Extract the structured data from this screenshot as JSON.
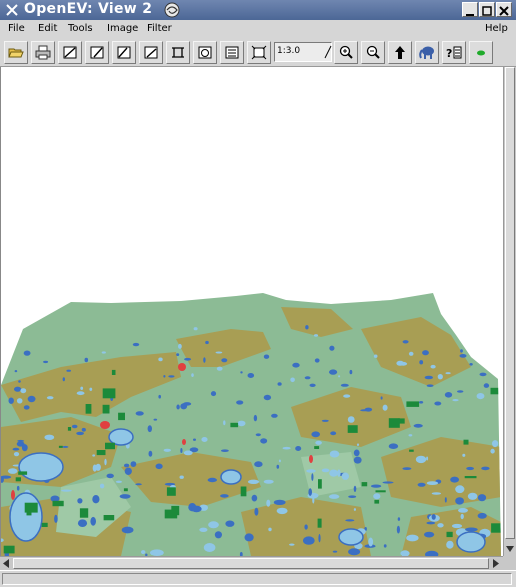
{
  "window": {
    "title": "OpenEV: View 2"
  },
  "menu": {
    "items": [
      "File",
      "Edit",
      "Tools",
      "Image",
      "Filter"
    ],
    "help": "Help"
  },
  "toolbar": {
    "buttons": [
      "open-icon",
      "print-icon",
      "select-tool-icon",
      "edit-tool-icon",
      "draw-tool-icon",
      "measure-tool-icon",
      "roi-tool-icon",
      "rotate-icon",
      "layers-icon",
      "fit-extents-icon",
      "zoom-in-icon",
      "zoom-out-icon",
      "up-arrow-icon",
      "elephant-icon",
      "help-info-icon",
      "green-dot-icon"
    ],
    "zoom_value": "1:3.0"
  },
  "status": {
    "text": ""
  },
  "colors": {
    "background": "#ffffff",
    "grassland": "#8cbb95",
    "cropland": "#a89e54",
    "forest": "#1c8a3a",
    "water_dark": "#3b6fc2",
    "water_light": "#8fc6e6",
    "urban": "#e04040"
  }
}
